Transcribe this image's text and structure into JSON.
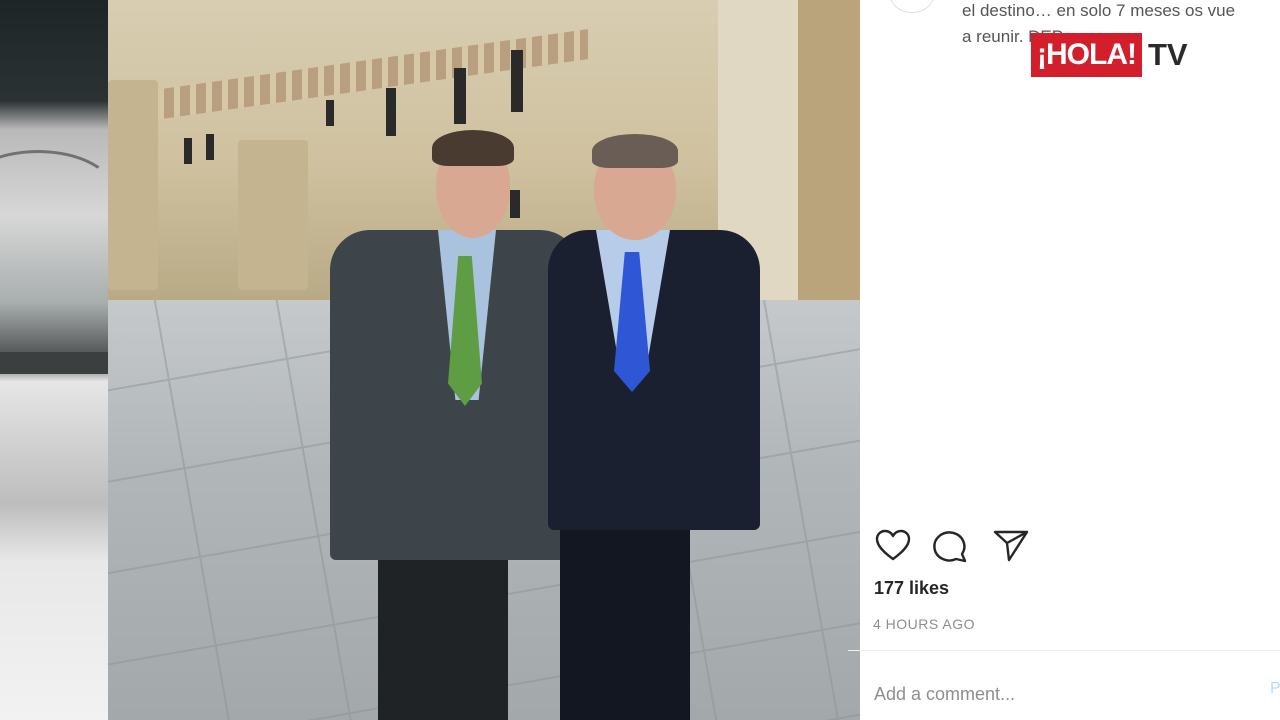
{
  "caption": {
    "line1": "el destino… en solo 7 meses os vue",
    "line2": "a reunir. DEP"
  },
  "logo": {
    "brand": "¡HOLA!",
    "suffix": "TV",
    "brand_color": "#d21f2b"
  },
  "post": {
    "likes": "177 likes",
    "timestamp": "4 HOURS AGO",
    "comment_placeholder": "Add a comment...",
    "post_label": "Post"
  },
  "icons": [
    "heart-icon",
    "comment-icon",
    "share-icon"
  ]
}
